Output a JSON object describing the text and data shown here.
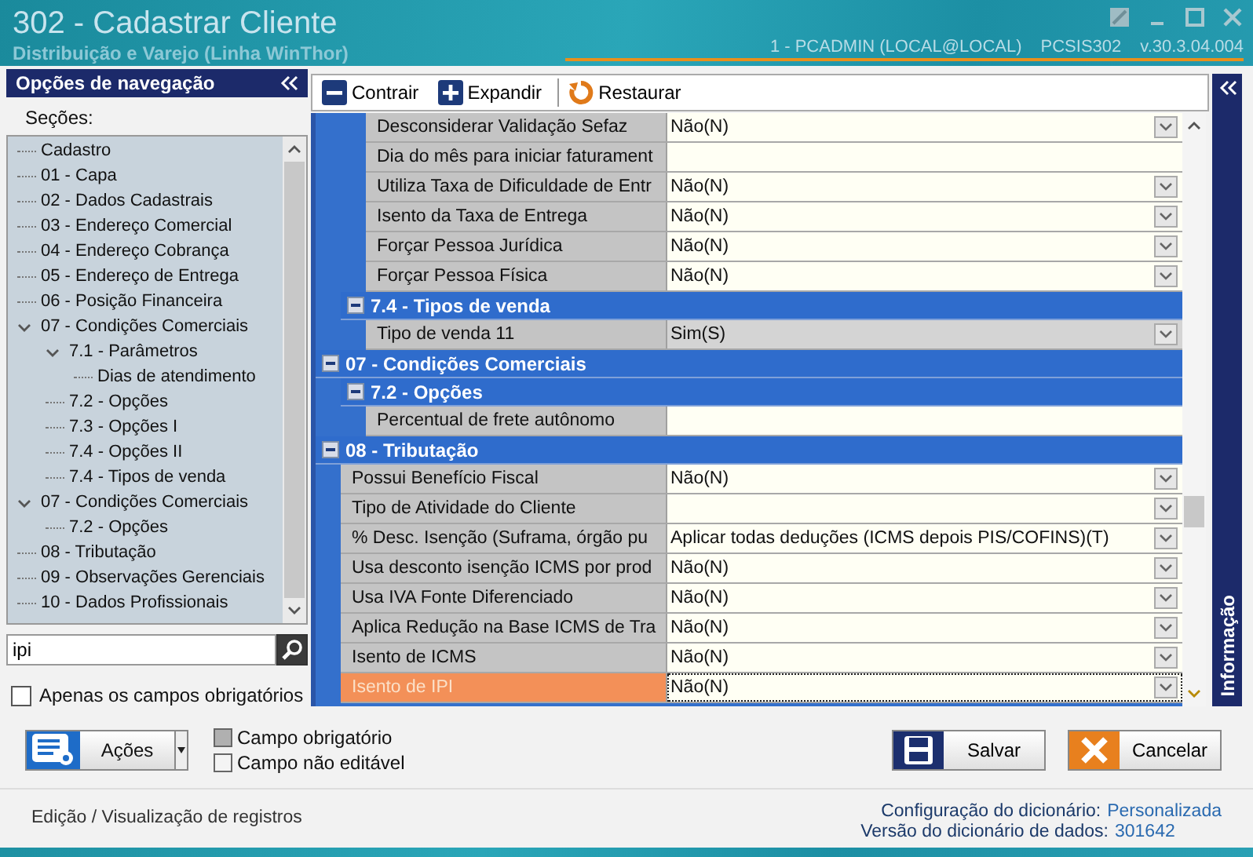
{
  "window": {
    "title": "302 - Cadastrar Cliente",
    "subtitle": "Distribuição e Varejo (Linha WinThor)",
    "user": "1 - PCADMIN (LOCAL@LOCAL)",
    "program": "PCSIS302",
    "version": "v.30.3.04.004"
  },
  "navigation": {
    "title": "Opções de navegação",
    "sections_label": "Seções:",
    "tree": [
      {
        "label": "Cadastro"
      },
      {
        "label": "01 - Capa"
      },
      {
        "label": "02 - Dados Cadastrais"
      },
      {
        "label": "03 - Endereço Comercial"
      },
      {
        "label": "04 - Endereço Cobrança"
      },
      {
        "label": "05 - Endereço de Entrega"
      },
      {
        "label": "06 - Posição Financeira"
      },
      {
        "label": "07 - Condições Comerciais",
        "expanded": true,
        "children": [
          {
            "label": "7.1 - Parâmetros",
            "expanded": true,
            "children": [
              {
                "label": "Dias de atendimento"
              }
            ]
          },
          {
            "label": "7.2 - Opções"
          },
          {
            "label": "7.3 - Opções I"
          },
          {
            "label": "7.4 - Opções II"
          },
          {
            "label": "7.4 - Tipos de venda"
          }
        ]
      },
      {
        "label": "07 - Condições Comerciais",
        "expanded": true,
        "children": [
          {
            "label": "7.2 - Opções"
          }
        ]
      },
      {
        "label": "08 - Tributação"
      },
      {
        "label": "09 - Observações Gerenciais"
      },
      {
        "label": "10 - Dados Profissionais"
      }
    ],
    "search": {
      "value": "ipi"
    },
    "required_only": {
      "label": "Apenas os campos obrigatórios",
      "checked": false
    }
  },
  "toolbar": [
    {
      "label": "Contrair",
      "kind": "collapse"
    },
    {
      "label": "Expandir",
      "kind": "expand"
    },
    {
      "label": "Restaurar",
      "kind": "restore"
    }
  ],
  "grid": {
    "items": [
      {
        "kind": "group",
        "children": [
          {
            "kind": "group",
            "children": [
              {
                "kind": "row",
                "label": "Desconsiderar Validação Sefaz",
                "value": "Não(N)",
                "dropdown": true,
                "selected": false,
                "match": false
              },
              {
                "kind": "row",
                "label": "Dia do mês para iniciar faturament",
                "dropdown": false,
                "selected": false,
                "match": false
              },
              {
                "kind": "row",
                "label": "Utiliza Taxa de Dificuldade de Entr",
                "value": "Não(N)",
                "dropdown": true,
                "selected": false,
                "match": false
              },
              {
                "kind": "row",
                "label": "Isento da Taxa de Entrega",
                "value": "Não(N)",
                "dropdown": true,
                "selected": false,
                "match": false
              },
              {
                "kind": "row",
                "label": "Forçar Pessoa Jurídica",
                "value": "Não(N)",
                "dropdown": true,
                "selected": false,
                "match": false
              },
              {
                "kind": "row",
                "label": "Forçar Pessoa Física",
                "value": "Não(N)",
                "dropdown": true,
                "selected": false,
                "match": false
              }
            ]
          },
          {
            "kind": "group",
            "title": "7.4 - Tipos de venda",
            "expanded": true,
            "children": [
              {
                "kind": "row",
                "label": "Tipo de venda 11",
                "value": "Sim(S)",
                "dropdown": true,
                "selected": true,
                "match": false
              }
            ]
          }
        ]
      },
      {
        "kind": "group",
        "title": "07 - Condições Comerciais",
        "expanded": true,
        "children": [
          {
            "kind": "group",
            "title": "7.2 - Opções",
            "expanded": true,
            "children": [
              {
                "kind": "row",
                "label": "Percentual de frete autônomo",
                "dropdown": false,
                "selected": false,
                "match": false
              }
            ]
          }
        ]
      },
      {
        "kind": "group",
        "title": "08 - Tributação",
        "expanded": true,
        "children": [
          {
            "kind": "row",
            "label": "Possui Benefício Fiscal",
            "value": "Não(N)",
            "dropdown": true,
            "selected": false,
            "match": false
          },
          {
            "kind": "row",
            "label": "Tipo de Atividade do Cliente",
            "dropdown": true,
            "selected": false,
            "match": false
          },
          {
            "kind": "row",
            "label": "% Desc. Isenção (Suframa, órgão pu",
            "value": "Aplicar todas deduções (ICMS depois PIS/COFINS)(T)",
            "dropdown": true,
            "selected": false,
            "match": false
          },
          {
            "kind": "row",
            "label": "Usa desconto isenção ICMS por prod",
            "value": "Não(N)",
            "dropdown": true,
            "selected": false,
            "match": false
          },
          {
            "kind": "row",
            "label": "Usa IVA Fonte Diferenciado",
            "value": "Não(N)",
            "dropdown": true,
            "selected": false,
            "match": false
          },
          {
            "kind": "row",
            "label": "Aplica Redução na Base ICMS de Tra",
            "value": "Não(N)",
            "dropdown": true,
            "selected": false,
            "match": false
          },
          {
            "kind": "row",
            "label": "Isento de ICMS",
            "value": "Não(N)",
            "dropdown": true,
            "selected": false,
            "match": false
          },
          {
            "kind": "row",
            "label": "Isento de IPI",
            "value": "Não(N)",
            "dropdown": true,
            "selected": false,
            "match": true
          }
        ]
      }
    ]
  },
  "info_panel": {
    "title": "Informação"
  },
  "actions": {
    "label": "Ações"
  },
  "legend": [
    {
      "label": "Campo obrigatório",
      "kind": "required"
    },
    {
      "label": "Campo não editável",
      "kind": "readonly"
    }
  ],
  "buttons": [
    {
      "label": "Salvar",
      "kind": "save"
    },
    {
      "label": "Cancelar",
      "kind": "cancel"
    }
  ],
  "status_bar": {
    "mode": "Edição / Visualização de registros",
    "config_label": "Configuração do dicionário:",
    "config_value": "Personalizada",
    "version_label": "Versão do dicionário de dados:",
    "version_value": "301642"
  }
}
